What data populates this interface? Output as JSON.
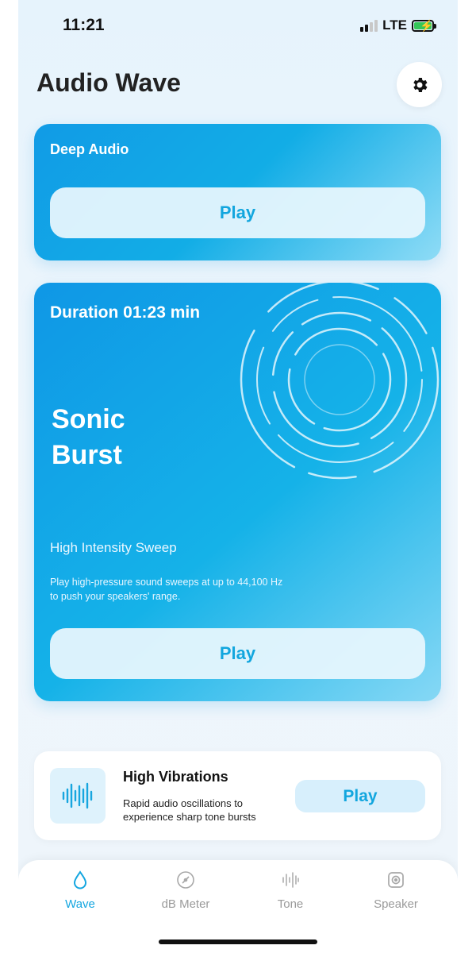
{
  "status": {
    "time": "11:21",
    "network": "LTE"
  },
  "app": {
    "title": "Audio Wave",
    "settings_icon": "gear-icon"
  },
  "deep_audio": {
    "label": "Deep Audio",
    "play": "Play"
  },
  "sonic_burst": {
    "duration": "Duration 01:23 min",
    "title_line1": "Sonic",
    "title_line2": "Burst",
    "subtitle": "High Intensity Sweep",
    "description": "Play high-pressure sound sweeps at up to 44,100 Hz to push your speakers' range.",
    "play": "Play"
  },
  "high_vibrations": {
    "title": "High Vibrations",
    "description": "Rapid audio oscillations to experience sharp tone bursts",
    "play": "Play",
    "icon": "waveform-icon"
  },
  "tabs": [
    {
      "label": "Wave",
      "icon": "droplet-icon",
      "active": true
    },
    {
      "label": "dB Meter",
      "icon": "gauge-icon",
      "active": false
    },
    {
      "label": "Tone",
      "icon": "tone-waveform-icon",
      "active": false
    },
    {
      "label": "Speaker",
      "icon": "speaker-icon",
      "active": false
    }
  ],
  "colors": {
    "accent": "#14a6e0",
    "card_start": "#119be6",
    "card_end": "#8fdcf6"
  }
}
